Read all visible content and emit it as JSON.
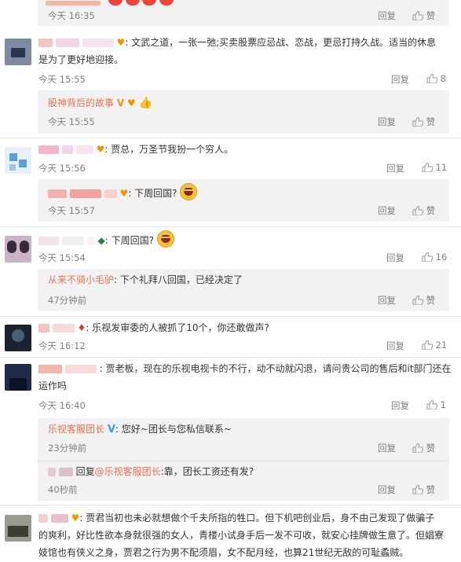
{
  "labels": {
    "reply": "回复",
    "like": "赞"
  },
  "top": {
    "time": "今天 16:35"
  },
  "comments": [
    {
      "text": ": 文武之道，一张一弛;买卖股票应忌战、恋战，更忌打持久战。适当的休息",
      "text2": "是为了更好地迎接。",
      "time": "今天 15:55",
      "likes": "8"
    },
    {
      "text": ": 贾总，万圣节我扮一个穷人。",
      "time": "今天 15:56",
      "likes": "11"
    },
    {
      "text": ": 下周回国?",
      "time": "今天 15:54",
      "likes": "16"
    },
    {
      "text": ": 乐视发审委的人被抓了10个，你还敢做声?",
      "time": "今天 16:12",
      "likes": "21"
    },
    {
      "text": ": 贾老板，现在的乐视电视卡的不行，动不动就闪退，请问贵公司的售后和it部门还在",
      "text2": "运作吗",
      "time": "今天 16:40",
      "likes": "1"
    },
    {
      "text": ": 贾君当初也未必就想做个千夫所指的牲口。但下机吧创业后，身不由己发现了做骗子",
      "text2": "的爽利，好比性欲本身就很强的女人，青楼小试身手后一发不可收，就安心挂牌做生意了。但娼寮",
      "text3": "妓馆也有侠义之身，贾君之行为男不配须眉，女不配月经，也算21世纪无敌的可耻蟊贼。"
    }
  ],
  "replies": [
    {
      "author": "股神背后的故事",
      "time": "今天 15:55"
    },
    {
      "text": ": 下周回国?",
      "time": "今天 15:57"
    },
    {
      "author": "从来不骑小毛驴",
      "text": ": 下个礼拜八回国，已经决定了",
      "time": "47分钟前"
    },
    {
      "author": "乐视客服团长",
      "text": ": 您好~团长与您私信联系~",
      "time": "23分钟前"
    },
    {
      "prefix": "回复",
      "mention": "@乐视客服团长",
      "text": ":靠，团长工资还有发?",
      "time": "40秒前"
    }
  ]
}
